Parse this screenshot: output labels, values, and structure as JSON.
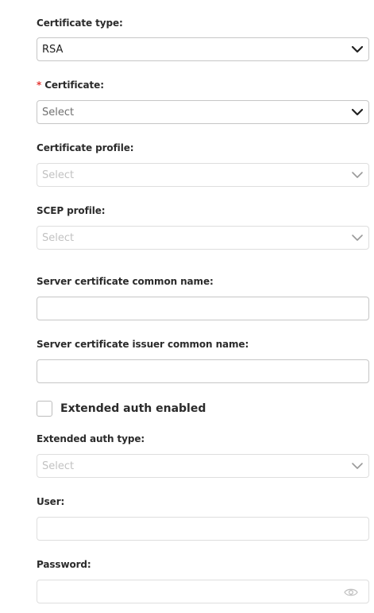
{
  "fields": {
    "certificate_type": {
      "label": "Certificate type:",
      "value": "RSA"
    },
    "certificate": {
      "required_marker": "*",
      "label": "Certificate:",
      "placeholder": "Select"
    },
    "certificate_profile": {
      "label": "Certificate profile:",
      "placeholder": "Select"
    },
    "scep_profile": {
      "label": "SCEP profile:",
      "placeholder": "Select"
    },
    "server_cert_common_name": {
      "label": "Server certificate common name:",
      "value": ""
    },
    "server_cert_issuer_common_name": {
      "label": "Server certificate issuer common name:",
      "value": ""
    },
    "extended_auth_enabled": {
      "label": "Extended auth enabled",
      "checked": false
    },
    "extended_auth_type": {
      "label": "Extended auth type:",
      "placeholder": "Select"
    },
    "user": {
      "label": "User:",
      "value": ""
    },
    "password": {
      "label": "Password:",
      "value": ""
    }
  },
  "icons": {
    "dropdown": "chevron-down-icon",
    "password_toggle": "eye-icon"
  },
  "colors": {
    "required": "#e53935",
    "border": "#c6c6c6",
    "border_disabled": "#dedede",
    "placeholder_disabled": "#c2c2c2"
  }
}
